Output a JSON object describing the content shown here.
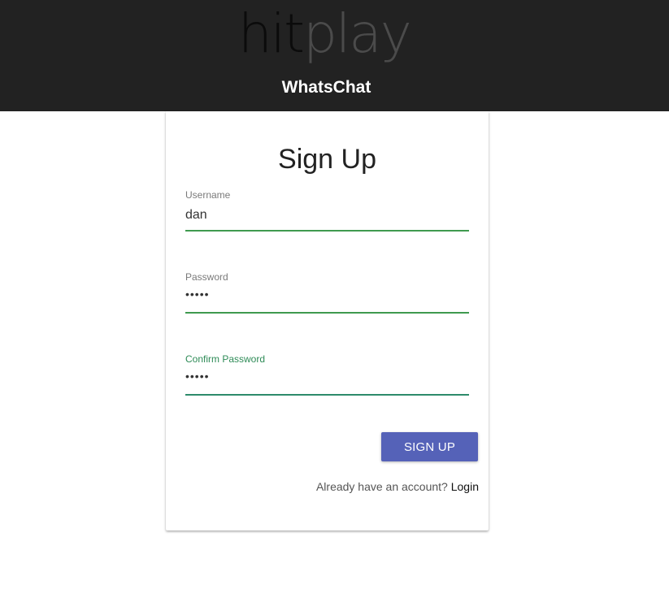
{
  "header": {
    "logo_part1": "hit",
    "logo_part2": "play",
    "app_title": "WhatsChat"
  },
  "signup_form": {
    "title": "Sign Up",
    "fields": [
      {
        "label": "Username",
        "value": "dan",
        "type": "text"
      },
      {
        "label": "Password",
        "value": "•••••",
        "type": "password"
      },
      {
        "label": "Confirm Password",
        "value": "•••••",
        "type": "password",
        "focused": true
      }
    ],
    "submit_label": "SIGN UP",
    "login_prompt": "Already have an account?",
    "login_link": "Login"
  },
  "colors": {
    "header_bg": "#222222",
    "button_bg": "#5562b8",
    "underline": "#3f9a4f",
    "focused_label": "#2e8b57"
  }
}
